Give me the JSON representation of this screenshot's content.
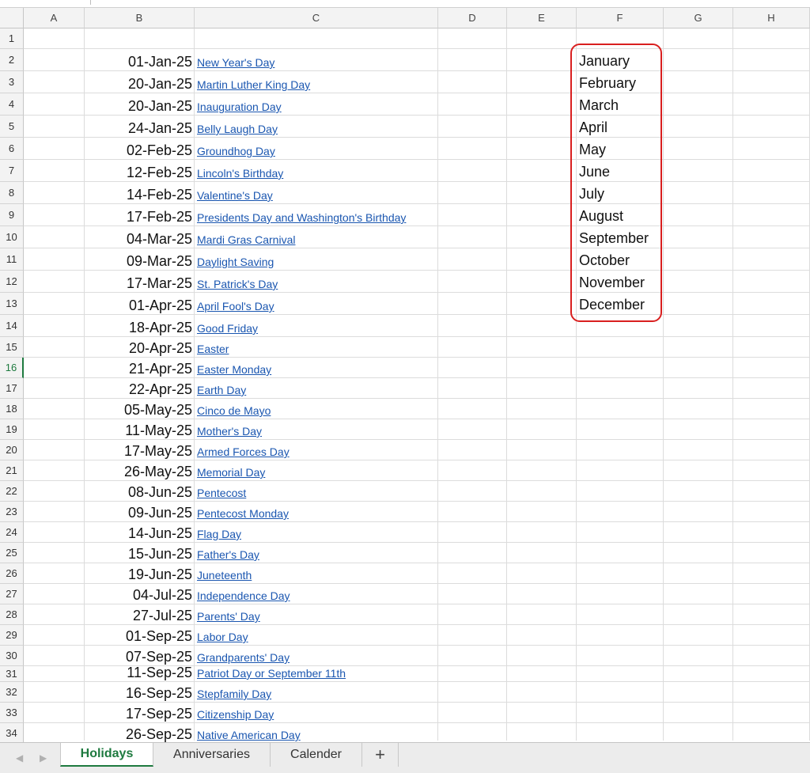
{
  "columns": [
    "A",
    "B",
    "C",
    "D",
    "E",
    "F",
    "G",
    "H"
  ],
  "rows": [
    {
      "num": "1",
      "date": "",
      "holiday": ""
    },
    {
      "num": "2",
      "date": "01-Jan-25",
      "holiday": "New Year's Day"
    },
    {
      "num": "3",
      "date": "20-Jan-25",
      "holiday": "Martin Luther King Day"
    },
    {
      "num": "4",
      "date": "20-Jan-25",
      "holiday": "Inauguration Day"
    },
    {
      "num": "5",
      "date": "24-Jan-25",
      "holiday": "Belly Laugh Day"
    },
    {
      "num": "6",
      "date": "02-Feb-25",
      "holiday": "Groundhog Day"
    },
    {
      "num": "7",
      "date": "12-Feb-25",
      "holiday": "Lincoln's Birthday"
    },
    {
      "num": "8",
      "date": "14-Feb-25",
      "holiday": "Valentine's Day"
    },
    {
      "num": "9",
      "date": "17-Feb-25",
      "holiday": "Presidents Day and Washington's Birthday"
    },
    {
      "num": "10",
      "date": "04-Mar-25",
      "holiday": "Mardi Gras Carnival "
    },
    {
      "num": "11",
      "date": "09-Mar-25",
      "holiday": "Daylight Saving "
    },
    {
      "num": "12",
      "date": "17-Mar-25",
      "holiday": "St. Patrick's Day"
    },
    {
      "num": "13",
      "date": "01-Apr-25",
      "holiday": "April Fool's Day"
    },
    {
      "num": "14",
      "date": "18-Apr-25",
      "holiday": "Good Friday"
    },
    {
      "num": "15",
      "date": "20-Apr-25",
      "holiday": "Easter"
    },
    {
      "num": "16",
      "date": "21-Apr-25",
      "holiday": "Easter Monday"
    },
    {
      "num": "17",
      "date": "22-Apr-25",
      "holiday": "Earth Day"
    },
    {
      "num": "18",
      "date": "05-May-25",
      "holiday": "Cinco de Mayo"
    },
    {
      "num": "19",
      "date": "11-May-25",
      "holiday": "Mother's Day"
    },
    {
      "num": "20",
      "date": "17-May-25",
      "holiday": "Armed Forces Day"
    },
    {
      "num": "21",
      "date": "26-May-25",
      "holiday": "Memorial Day"
    },
    {
      "num": "22",
      "date": "08-Jun-25",
      "holiday": "Pentecost"
    },
    {
      "num": "23",
      "date": "09-Jun-25",
      "holiday": "Pentecost Monday"
    },
    {
      "num": "24",
      "date": "14-Jun-25",
      "holiday": "Flag Day"
    },
    {
      "num": "25",
      "date": "15-Jun-25",
      "holiday": "Father's Day"
    },
    {
      "num": "26",
      "date": "19-Jun-25",
      "holiday": "Juneteenth"
    },
    {
      "num": "27",
      "date": "04-Jul-25",
      "holiday": "Independence Day"
    },
    {
      "num": "28",
      "date": "27-Jul-25",
      "holiday": "Parents' Day"
    },
    {
      "num": "29",
      "date": "01-Sep-25",
      "holiday": "Labor Day"
    },
    {
      "num": "30",
      "date": "07-Sep-25",
      "holiday": "Grandparents' Day"
    },
    {
      "num": "31",
      "date": "11-Sep-25",
      "holiday": "Patriot Day or September 11th"
    },
    {
      "num": "32",
      "date": "16-Sep-25",
      "holiday": "Stepfamily Day"
    },
    {
      "num": "33",
      "date": "17-Sep-25",
      "holiday": "Citizenship Day"
    },
    {
      "num": "34",
      "date": "26-Sep-25",
      "holiday": "Native American Day"
    }
  ],
  "months": [
    "January",
    "February",
    "March",
    "April",
    "May",
    "June",
    "July",
    "August",
    "September",
    "October",
    "November",
    "December"
  ],
  "active_row": "16",
  "sheet_tabs": [
    {
      "label": "Holidays",
      "active": true
    },
    {
      "label": "Anniversaries",
      "active": false
    },
    {
      "label": "Calender",
      "active": false
    }
  ],
  "add_sheet_label": "+",
  "nav": {
    "prev_icon": "◀",
    "next_icon": "▶"
  },
  "colors": {
    "link": "#1a56b0",
    "accent": "#1e7a3f",
    "highlight_border": "#d91f1f"
  }
}
